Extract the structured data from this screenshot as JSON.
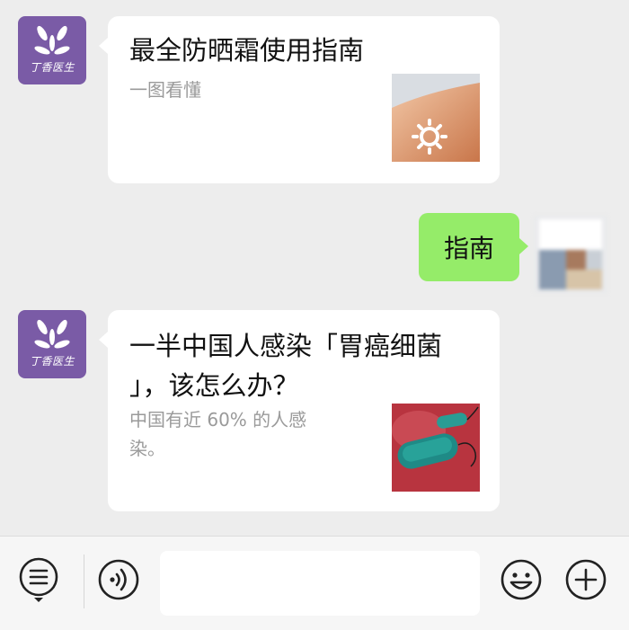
{
  "brand": {
    "avatar_caption": "丁香医生",
    "accent": "#7a5ba6"
  },
  "messages": [
    {
      "title": "最全防晒霜使用指南",
      "summary": "一图看懂",
      "thumbnail_icon": "sunscreen-arm-icon"
    },
    {
      "text": "指南",
      "bubble_color": "#95ec69"
    },
    {
      "title_line1": "一半中国人感染「胃癌细菌",
      "title_line2": "」，该怎么办？",
      "summary_line1": "中国有近 60% 的人感",
      "summary_line2": "染。",
      "thumbnail_icon": "bacteria-icon"
    }
  ],
  "input_bar": {
    "menu_icon": "list-menu-icon",
    "voice_icon": "voice-icon",
    "emoji_icon": "emoji-icon",
    "plus_icon": "plus-icon",
    "input_value": ""
  }
}
